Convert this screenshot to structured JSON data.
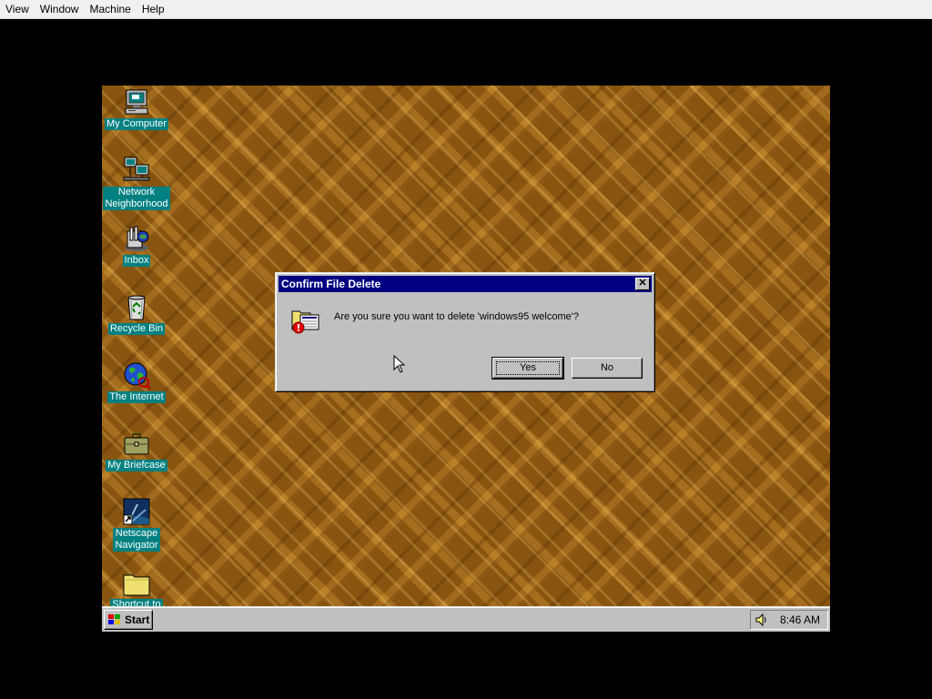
{
  "host_menu": {
    "items": [
      "View",
      "Window",
      "Machine",
      "Help"
    ]
  },
  "desktop": {
    "wallpaper_color": "#9a6316",
    "icons": [
      {
        "label": "My Computer",
        "icon": "my-computer-icon"
      },
      {
        "label": "Network\nNeighborhood",
        "icon": "network-neighborhood-icon"
      },
      {
        "label": "Inbox",
        "icon": "inbox-icon"
      },
      {
        "label": "Recycle Bin",
        "icon": "recycle-bin-icon"
      },
      {
        "label": "The Internet",
        "icon": "internet-icon"
      },
      {
        "label": "My Briefcase",
        "icon": "briefcase-icon"
      },
      {
        "label": "Netscape\nNavigator",
        "icon": "netscape-icon"
      },
      {
        "label": "Shortcut to",
        "icon": "folder-icon"
      }
    ]
  },
  "dialog": {
    "title": "Confirm File Delete",
    "message": "Are you sure you want to delete 'windows95 welcome'?",
    "icon": "delete-file-warning-icon",
    "yes_label": "Yes",
    "no_label": "No",
    "close_glyph": "✕",
    "titlebar_color": "#000080"
  },
  "taskbar": {
    "start_label": "Start",
    "clock": "8:46 AM",
    "tray_icon": "speaker-icon"
  },
  "colors": {
    "face": "#c0c0c0",
    "icon_label_bg": "#008080"
  }
}
